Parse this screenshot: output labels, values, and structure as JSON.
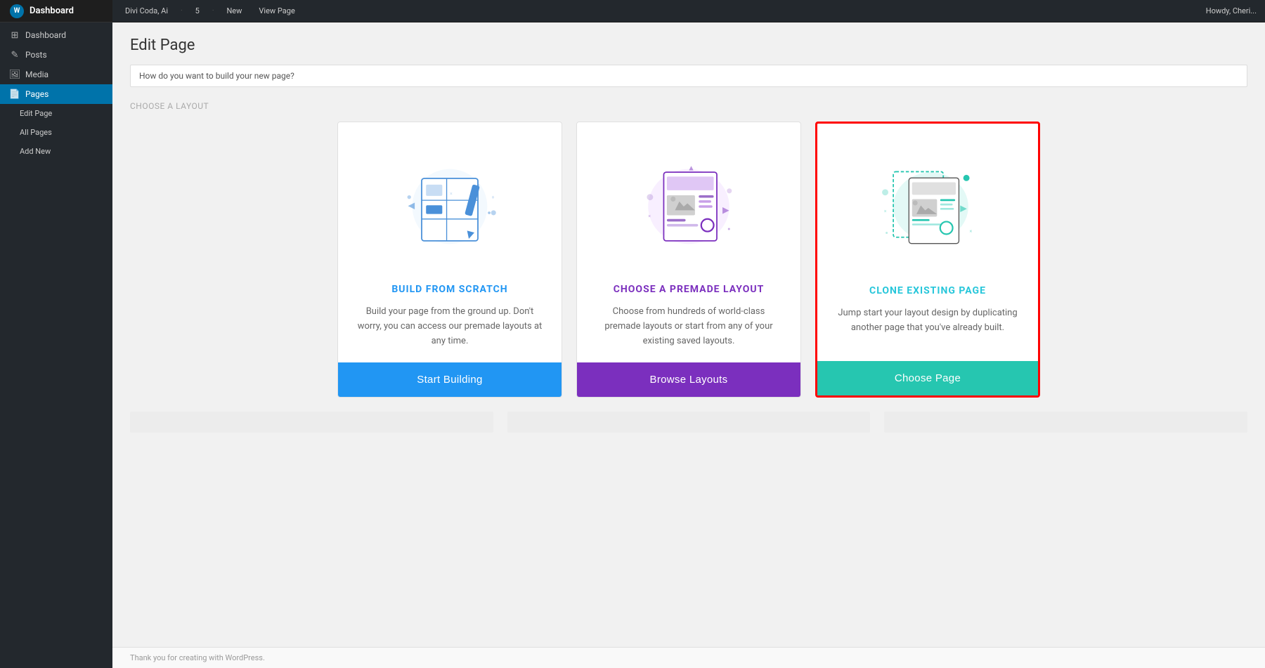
{
  "topbar": {
    "items": [
      "Divi Coda, Ai",
      "·",
      "5",
      "·",
      "New",
      "View Page"
    ],
    "right_label": "Howdy, Cheri..."
  },
  "sidebar": {
    "logo_text": "Dashboard",
    "nav_items": [
      {
        "label": "Dashboard",
        "icon": "⊞",
        "active": false
      },
      {
        "label": "Posts",
        "icon": "📝",
        "active": false
      },
      {
        "label": "Media",
        "icon": "🖼",
        "active": false
      },
      {
        "label": "Pages",
        "icon": "📄",
        "active": true
      },
      {
        "label": "Edit Page",
        "icon": "",
        "active": false,
        "sub": true
      },
      {
        "label": "All Pages",
        "icon": "",
        "active": false,
        "sub": true
      },
      {
        "label": "Add New",
        "icon": "",
        "active": false,
        "sub": true
      }
    ]
  },
  "page": {
    "title": "Edit Page",
    "edit_bar_text": "How do you want to build your new page?",
    "options_label": "Choose a Layout"
  },
  "cards": [
    {
      "id": "build-from-scratch",
      "title": "BUILD FROM SCRATCH",
      "title_class": "blue",
      "description": "Build your page from the ground up. Don't worry, you can access our premade layouts at any time.",
      "button_label": "Start Building",
      "button_class": "btn-blue",
      "selected": false
    },
    {
      "id": "choose-premade-layout",
      "title": "CHOOSE A PREMADE LAYOUT",
      "title_class": "purple",
      "description": "Choose from hundreds of world-class premade layouts or start from any of your existing saved layouts.",
      "button_label": "Browse Layouts",
      "button_class": "btn-purple",
      "selected": false
    },
    {
      "id": "clone-existing-page",
      "title": "CLONE EXISTING PAGE",
      "title_class": "teal",
      "description": "Jump start your layout design by duplicating another page that you've already built.",
      "button_label": "Choose Page",
      "button_class": "btn-teal",
      "selected": true
    }
  ],
  "footer": {
    "text": "Thank you for creating with WordPress."
  }
}
